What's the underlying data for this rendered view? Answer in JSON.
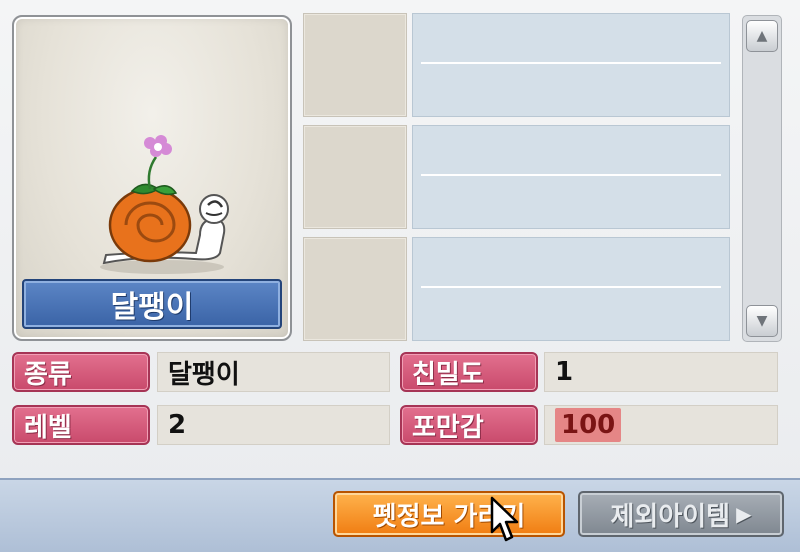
{
  "pet": {
    "name": "달팽이"
  },
  "info": {
    "species_label": "종류",
    "species_value": "달팽이",
    "closeness_label": "친밀도",
    "closeness_value": "1",
    "level_label": "레벨",
    "level_value": "2",
    "fullness_label": "포만감",
    "fullness_value": "100"
  },
  "buttons": {
    "show_pet_info": "펫정보 가리기",
    "except_items": "제외아이템",
    "except_items_arrow": "▶"
  },
  "icons": {
    "scroll_up": "▲",
    "scroll_down": "▼"
  },
  "colors": {
    "label_pink": "#d65a7b",
    "name_bar_blue": "#3a63a6",
    "button_orange": "#f07d12",
    "fullness_highlight": "#e58686"
  }
}
